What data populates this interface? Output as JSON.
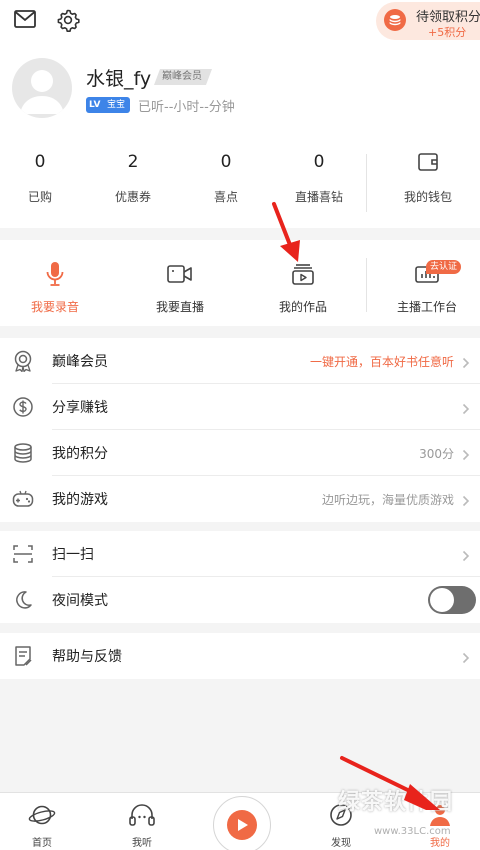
{
  "topbar": {
    "mail_icon": "mail-icon",
    "settings_icon": "gear-icon",
    "points_pill": {
      "title": "待领取积分",
      "reward": "+5积分"
    }
  },
  "profile": {
    "username": "水银_fy",
    "member_tag": "巅峰会员",
    "level_badge": {
      "prefix": "LV",
      "name": "宝宝"
    },
    "listen_time": "已听--小时--分钟"
  },
  "stats": [
    {
      "value": "0",
      "label": "已购"
    },
    {
      "value": "2",
      "label": "优惠券"
    },
    {
      "value": "0",
      "label": "喜点"
    },
    {
      "value": "0",
      "label": "直播喜钻"
    }
  ],
  "wallet": {
    "label": "我的钱包",
    "icon": "wallet-icon"
  },
  "studio_tools": [
    {
      "label": "我要录音",
      "icon": "microphone-icon",
      "active": true
    },
    {
      "label": "我要直播",
      "icon": "video-camera-icon"
    },
    {
      "label": "我的作品",
      "icon": "my-works-icon"
    },
    {
      "label": "主播工作台",
      "icon": "workbench-icon",
      "badge": "去认证"
    }
  ],
  "menu_group_1": [
    {
      "label": "巅峰会员",
      "value": "一键开通，百本好书任意听",
      "icon": "medal-icon"
    },
    {
      "label": "分享赚钱",
      "value": "",
      "icon": "dollar-icon"
    },
    {
      "label": "我的积分",
      "value": "300分",
      "icon": "coins-stack-icon"
    },
    {
      "label": "我的游戏",
      "value": "边听边玩，海量优质游戏",
      "icon": "gamepad-icon"
    }
  ],
  "menu_group_2": [
    {
      "label": "扫一扫",
      "icon": "scan-icon"
    },
    {
      "label": "夜间模式",
      "icon": "moon-icon",
      "toggle": "off"
    }
  ],
  "menu_group_3": [
    {
      "label": "帮助与反馈",
      "icon": "feedback-icon"
    }
  ],
  "tabbar": [
    {
      "label": "首页",
      "icon": "planet-icon"
    },
    {
      "label": "我听",
      "icon": "headphones-icon"
    },
    {
      "label": "",
      "icon": "play-icon"
    },
    {
      "label": "发现",
      "icon": "discover-icon"
    },
    {
      "label": "我的",
      "icon": "profile-icon",
      "active": true
    }
  ],
  "watermark": {
    "logo": "绿茶软件园",
    "url": "www.33LC.com"
  },
  "colors": {
    "accent": "#f06a45",
    "badge_blue": "#3d84e8",
    "arrow_red": "#e8231c"
  }
}
